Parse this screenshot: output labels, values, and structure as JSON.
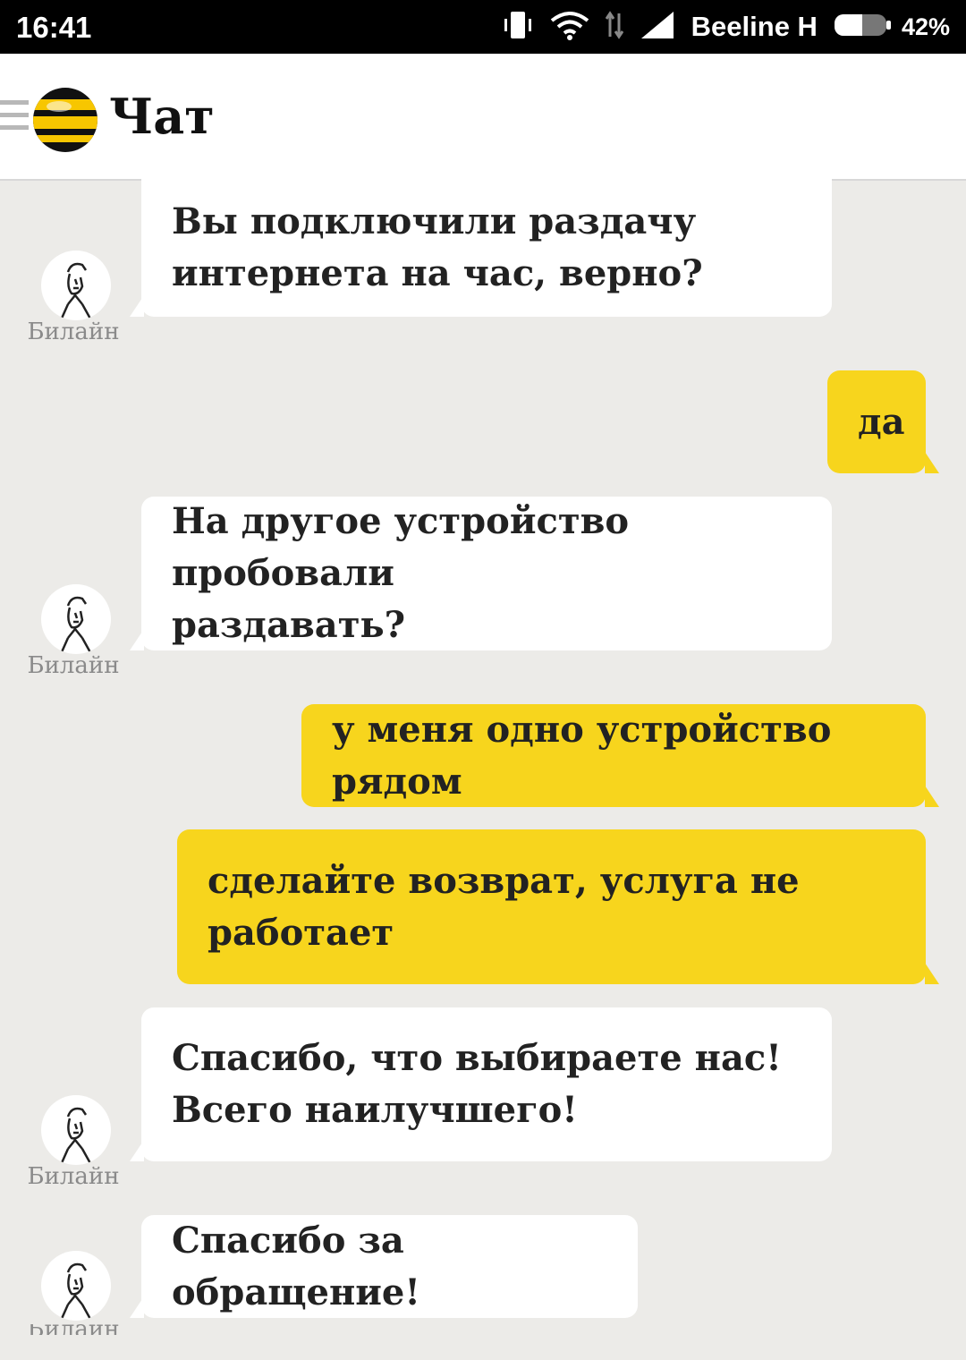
{
  "status_bar": {
    "time": "16:41",
    "carrier": "Beeline H",
    "battery": "42%",
    "icons": [
      "vibrate-icon",
      "wifi-icon",
      "data-arrows-icon",
      "signal-icon",
      "battery-icon"
    ]
  },
  "header": {
    "title": "Чат",
    "menu_icon": "menu-icon",
    "logo": "beeline-logo"
  },
  "colors": {
    "background": "#ecebe8",
    "user_bubble": "#f7d51d",
    "bot_bubble": "#ffffff",
    "status_bar": "#000000"
  },
  "messages": [
    {
      "sender": "bot",
      "text": "Вы подключили раздачу\nинтернета на час, верно?",
      "author": "Билайн"
    },
    {
      "sender": "user",
      "text": "да"
    },
    {
      "sender": "bot",
      "text": "На другое устройство пробовали\nраздавать?",
      "author": "Билайн"
    },
    {
      "sender": "user",
      "text": "у меня одно устройство рядом"
    },
    {
      "sender": "user",
      "text": "сделайте возврат, услуга не\nработает"
    },
    {
      "sender": "bot",
      "text": "Спасибо, что выбираете нас!\nВсего наилучшего!",
      "author": "Билайн"
    },
    {
      "sender": "bot",
      "text": "Спасибо за обращение!",
      "author": "Билайн"
    }
  ]
}
